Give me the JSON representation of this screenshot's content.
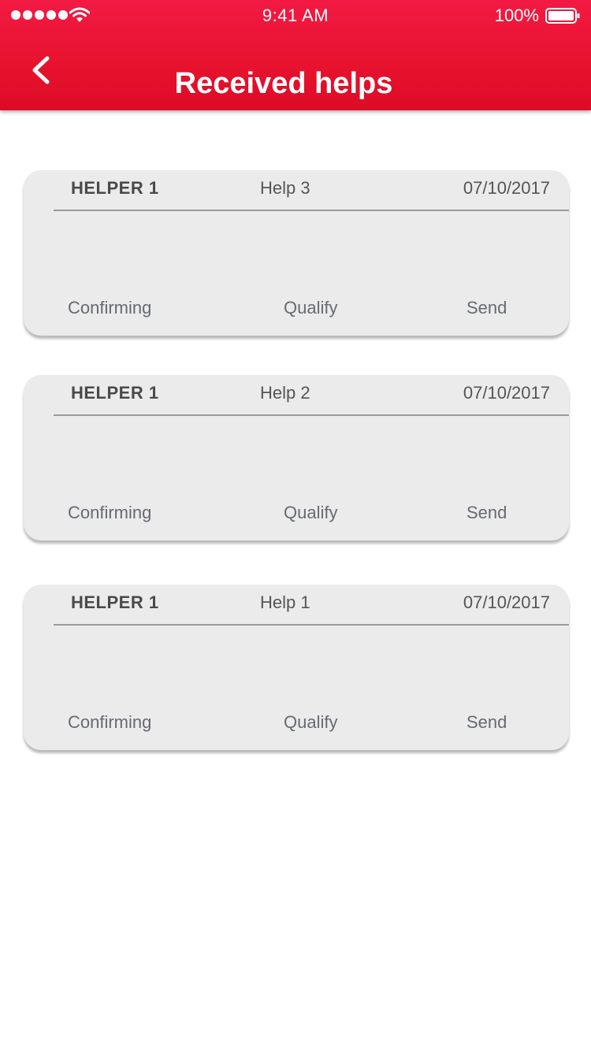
{
  "status_bar": {
    "time": "9:41 AM",
    "battery": "100%"
  },
  "header": {
    "title": "Received helps",
    "back_icon": "chevron-left-icon"
  },
  "colors": {
    "header": "#e8132f",
    "card_background": "#ebebeb",
    "text_dark": "#4a4a4a"
  },
  "cards": [
    {
      "helper": "HELPER 1",
      "help": "Help 3",
      "date": "07/10/2017",
      "actions": {
        "confirming": "Confirming",
        "qualify": "Qualify",
        "send": "Send"
      }
    },
    {
      "helper": "HELPER 1",
      "help": "Help 2",
      "date": "07/10/2017",
      "actions": {
        "confirming": "Confirming",
        "qualify": "Qualify",
        "send": "Send"
      }
    },
    {
      "helper": "HELPER 1",
      "help": "Help 1",
      "date": "07/10/2017",
      "actions": {
        "confirming": "Confirming",
        "qualify": "Qualify",
        "send": "Send"
      }
    }
  ]
}
